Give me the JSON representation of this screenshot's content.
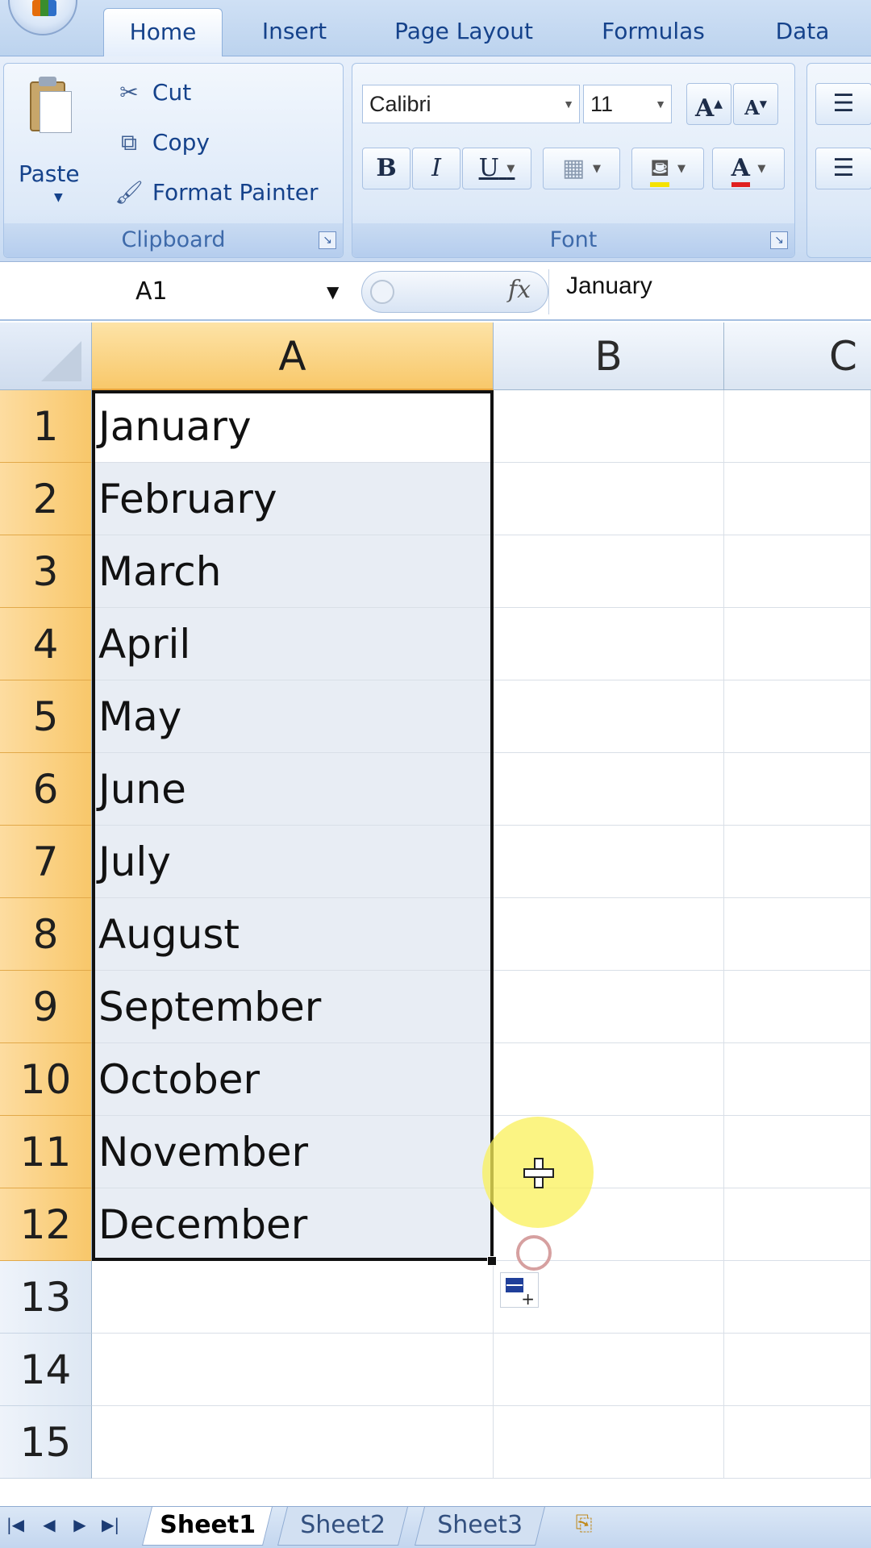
{
  "ribbon": {
    "tabs": [
      "Home",
      "Insert",
      "Page Layout",
      "Formulas",
      "Data"
    ],
    "active_tab": "Home",
    "clipboard": {
      "paste_label": "Paste",
      "cut_label": "Cut",
      "copy_label": "Copy",
      "format_painter_label": "Format Painter",
      "group_label": "Clipboard"
    },
    "font": {
      "font_name": "Calibri",
      "font_size": "11",
      "bold": "B",
      "italic": "I",
      "underline": "U",
      "grow": "A",
      "shrink": "A",
      "font_color_glyph": "A",
      "group_label": "Font",
      "highlight_color": "#f5e200",
      "font_color": "#e02020"
    }
  },
  "formula_bar": {
    "name_box": "A1",
    "fx": "fx",
    "content": "January"
  },
  "sheet": {
    "columns": [
      "A",
      "B",
      "C"
    ],
    "selected_column": "A",
    "rows": [
      {
        "num": "1",
        "a": "January"
      },
      {
        "num": "2",
        "a": "February"
      },
      {
        "num": "3",
        "a": "March"
      },
      {
        "num": "4",
        "a": "April"
      },
      {
        "num": "5",
        "a": "May"
      },
      {
        "num": "6",
        "a": "June"
      },
      {
        "num": "7",
        "a": "July"
      },
      {
        "num": "8",
        "a": "August"
      },
      {
        "num": "9",
        "a": "September"
      },
      {
        "num": "10",
        "a": "October"
      },
      {
        "num": "11",
        "a": "November"
      },
      {
        "num": "12",
        "a": "December"
      },
      {
        "num": "13",
        "a": ""
      },
      {
        "num": "14",
        "a": ""
      },
      {
        "num": "15",
        "a": ""
      }
    ],
    "selection": "A1:A12",
    "active_cell": "A1"
  },
  "sheet_tabs": {
    "tabs": [
      "Sheet1",
      "Sheet2",
      "Sheet3"
    ],
    "active": "Sheet1"
  },
  "colors": {
    "selected_header": "#f8c86a",
    "ribbon_text": "#15428b",
    "cursor_highlight": "#faf05a"
  }
}
